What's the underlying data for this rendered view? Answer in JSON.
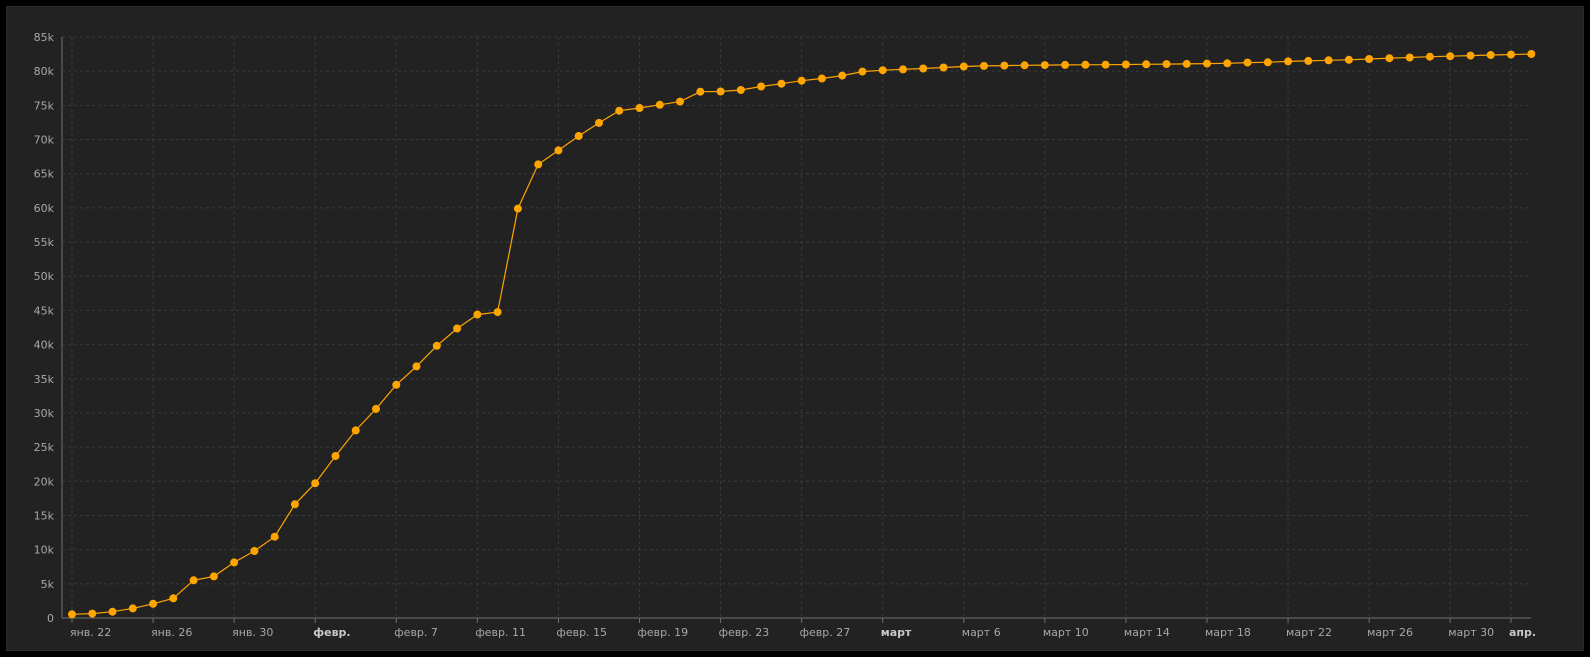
{
  "chart_data": {
    "type": "line",
    "title": "",
    "xlabel": "",
    "ylabel": "",
    "x_start": "2020-01-22",
    "x_end": "2020-04-02",
    "ylim": [
      0,
      85000
    ],
    "y_ticks": [
      {
        "value": 0,
        "label": "0"
      },
      {
        "value": 5000,
        "label": "5k"
      },
      {
        "value": 10000,
        "label": "10k"
      },
      {
        "value": 15000,
        "label": "15k"
      },
      {
        "value": 20000,
        "label": "20k"
      },
      {
        "value": 25000,
        "label": "25k"
      },
      {
        "value": 30000,
        "label": "30k"
      },
      {
        "value": 35000,
        "label": "35k"
      },
      {
        "value": 40000,
        "label": "40k"
      },
      {
        "value": 45000,
        "label": "45k"
      },
      {
        "value": 50000,
        "label": "50k"
      },
      {
        "value": 55000,
        "label": "55k"
      },
      {
        "value": 60000,
        "label": "60k"
      },
      {
        "value": 65000,
        "label": "65k"
      },
      {
        "value": 70000,
        "label": "70k"
      },
      {
        "value": 75000,
        "label": "75k"
      },
      {
        "value": 80000,
        "label": "80k"
      },
      {
        "value": 85000,
        "label": "85k"
      }
    ],
    "x_ticks": [
      {
        "date": "2020-01-22",
        "label": "янв. 22",
        "major": false
      },
      {
        "date": "2020-01-26",
        "label": "янв. 26",
        "major": false
      },
      {
        "date": "2020-01-30",
        "label": "янв. 30",
        "major": false
      },
      {
        "date": "2020-02-03",
        "label": "февр.",
        "major": true
      },
      {
        "date": "2020-02-07",
        "label": "февр. 7",
        "major": false
      },
      {
        "date": "2020-02-11",
        "label": "февр. 11",
        "major": false
      },
      {
        "date": "2020-02-15",
        "label": "февр. 15",
        "major": false
      },
      {
        "date": "2020-02-19",
        "label": "февр. 19",
        "major": false
      },
      {
        "date": "2020-02-23",
        "label": "февр. 23",
        "major": false
      },
      {
        "date": "2020-02-27",
        "label": "февр. 27",
        "major": false
      },
      {
        "date": "2020-03-02",
        "label": "март",
        "major": true
      },
      {
        "date": "2020-03-06",
        "label": "март 6",
        "major": false
      },
      {
        "date": "2020-03-10",
        "label": "март 10",
        "major": false
      },
      {
        "date": "2020-03-14",
        "label": "март 14",
        "major": false
      },
      {
        "date": "2020-03-18",
        "label": "март 18",
        "major": false
      },
      {
        "date": "2020-03-22",
        "label": "март 22",
        "major": false
      },
      {
        "date": "2020-03-26",
        "label": "март 26",
        "major": false
      },
      {
        "date": "2020-03-30",
        "label": "март 30",
        "major": false
      },
      {
        "date": "2020-04-02",
        "label": "апр.",
        "major": true
      }
    ],
    "grid": true,
    "legend": "none",
    "series": [
      {
        "color": "#ffa500",
        "x": [
          "2020-01-22",
          "2020-01-23",
          "2020-01-24",
          "2020-01-25",
          "2020-01-26",
          "2020-01-27",
          "2020-01-28",
          "2020-01-29",
          "2020-01-30",
          "2020-01-31",
          "2020-02-01",
          "2020-02-02",
          "2020-02-03",
          "2020-02-04",
          "2020-02-05",
          "2020-02-06",
          "2020-02-07",
          "2020-02-08",
          "2020-02-09",
          "2020-02-10",
          "2020-02-11",
          "2020-02-12",
          "2020-02-13",
          "2020-02-14",
          "2020-02-15",
          "2020-02-16",
          "2020-02-17",
          "2020-02-18",
          "2020-02-19",
          "2020-02-20",
          "2020-02-21",
          "2020-02-22",
          "2020-02-23",
          "2020-02-24",
          "2020-02-25",
          "2020-02-26",
          "2020-02-27",
          "2020-02-28",
          "2020-02-29",
          "2020-03-01",
          "2020-03-02",
          "2020-03-03",
          "2020-03-04",
          "2020-03-05",
          "2020-03-06",
          "2020-03-07",
          "2020-03-08",
          "2020-03-09",
          "2020-03-10",
          "2020-03-11",
          "2020-03-12",
          "2020-03-13",
          "2020-03-14",
          "2020-03-15",
          "2020-03-16",
          "2020-03-17",
          "2020-03-18",
          "2020-03-19",
          "2020-03-20",
          "2020-03-21",
          "2020-03-22",
          "2020-03-23",
          "2020-03-24",
          "2020-03-25",
          "2020-03-26",
          "2020-03-27",
          "2020-03-28",
          "2020-03-29",
          "2020-03-30",
          "2020-03-31",
          "2020-04-01",
          "2020-04-02",
          "2020-04-03"
        ],
        "values": [
          548,
          643,
          920,
          1406,
          2075,
          2877,
          5509,
          6087,
          8141,
          9802,
          11891,
          16630,
          19716,
          23707,
          27440,
          30587,
          34110,
          36814,
          39829,
          42354,
          44386,
          44759,
          59895,
          66358,
          68413,
          70513,
          72434,
          74211,
          74619,
          75077,
          75550,
          77001,
          77022,
          77241,
          77754,
          78166,
          78600,
          78928,
          79356,
          79932,
          80136,
          80261,
          80386,
          80537,
          80690,
          80770,
          80823,
          80860,
          80887,
          80921,
          80932,
          80945,
          80977,
          81003,
          81033,
          81058,
          81102,
          81156,
          81250,
          81305,
          81435,
          81498,
          81591,
          81661,
          81782,
          81897,
          81999,
          82122,
          82198,
          82279,
          82361,
          82432,
          82511
        ]
      }
    ]
  }
}
